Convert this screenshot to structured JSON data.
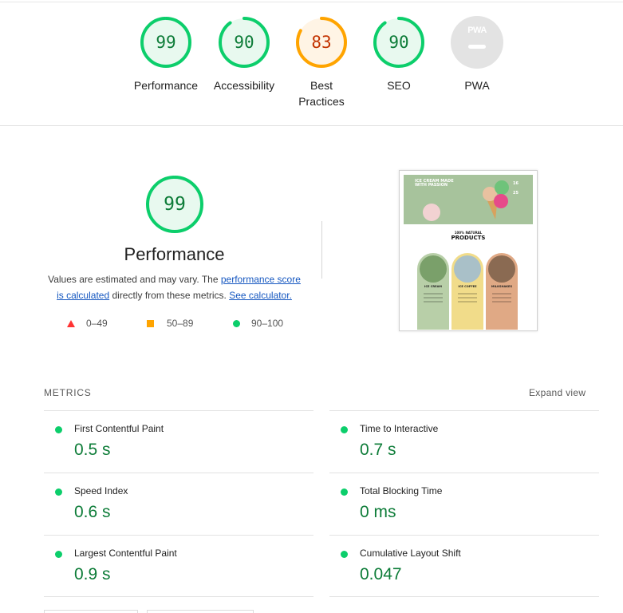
{
  "gauges": [
    {
      "score": "99",
      "label": "Performance",
      "color": "#0cce6b",
      "text_color": "#0d7c38",
      "fill": "#e8f9ef",
      "fraction": 0.99
    },
    {
      "score": "90",
      "label": "Accessibility",
      "color": "#0cce6b",
      "text_color": "#0d7c38",
      "fill": "#e8f9ef",
      "fraction": 0.9
    },
    {
      "score": "83",
      "label_line1": "Best",
      "label_line2": "Practices",
      "color": "#ffa400",
      "text_color": "#c33300",
      "fill": "#fff4e5",
      "fraction": 0.83
    },
    {
      "score": "90",
      "label": "SEO",
      "color": "#0cce6b",
      "text_color": "#0d7c38",
      "fill": "#e8f9ef",
      "fraction": 0.9
    },
    {
      "label": "PWA",
      "badge_text": "PWA",
      "icon": "pwa-badge-icon"
    }
  ],
  "performance": {
    "score": "99",
    "title": "Performance",
    "desc_prefix": "Values are estimated and may vary. The ",
    "desc_link1": "performance score is calculated",
    "desc_middle": " directly from these metrics. ",
    "desc_link2": "See calculator."
  },
  "legend": {
    "fail": "0–49",
    "average": "50–89",
    "pass": "90–100"
  },
  "screenshot": {
    "hero_text": "ICE CREAM MADE WITH PASSION",
    "num_a": "16",
    "num_b": "25",
    "subtitle": "100% NATURAL",
    "title": "PRODUCTS",
    "cards": [
      "ICE CREAM",
      "ICE COFFEE",
      "MILKSHAKES"
    ],
    "card_colors": [
      "#b8cfa8",
      "#f1dc8a",
      "#e0a985"
    ]
  },
  "metrics": {
    "heading": "METRICS",
    "expand_label": "Expand view",
    "items": [
      {
        "name": "First Contentful Paint",
        "value": "0.5 s"
      },
      {
        "name": "Time to Interactive",
        "value": "0.7 s"
      },
      {
        "name": "Speed Index",
        "value": "0.6 s"
      },
      {
        "name": "Total Blocking Time",
        "value": "0 ms"
      },
      {
        "name": "Largest Contentful Paint",
        "value": "0.9 s"
      },
      {
        "name": "Cumulative Layout Shift",
        "value": "0.047"
      }
    ]
  }
}
